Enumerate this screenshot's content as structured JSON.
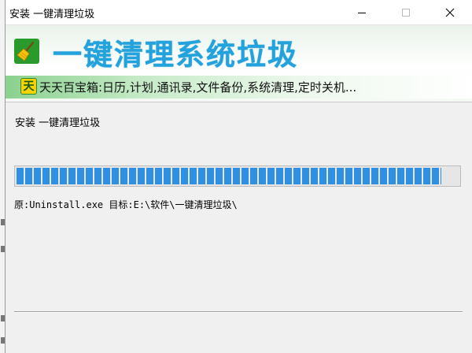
{
  "window": {
    "title": "安装 一键清理垃圾"
  },
  "banner": {
    "title": "一键清理系统垃圾",
    "promo_icon_char": "天",
    "promo_text": "天天百宝箱:日历,计划,通讯录,文件备份,系统清理,定时关机..."
  },
  "install": {
    "status": "安装 一键清理垃圾",
    "progress_fraction": 0.96,
    "detail": "原:Uninstall.exe 目标:E:\\软件\\一键清理垃圾\\"
  },
  "colors": {
    "accent_title": "#23a3dd",
    "progress": "#2f8fe0",
    "promo_green": "#8bd18f"
  },
  "icons": [
    "broom-icon",
    "tian-icon",
    "minimize-icon",
    "maximize-icon",
    "close-icon"
  ]
}
